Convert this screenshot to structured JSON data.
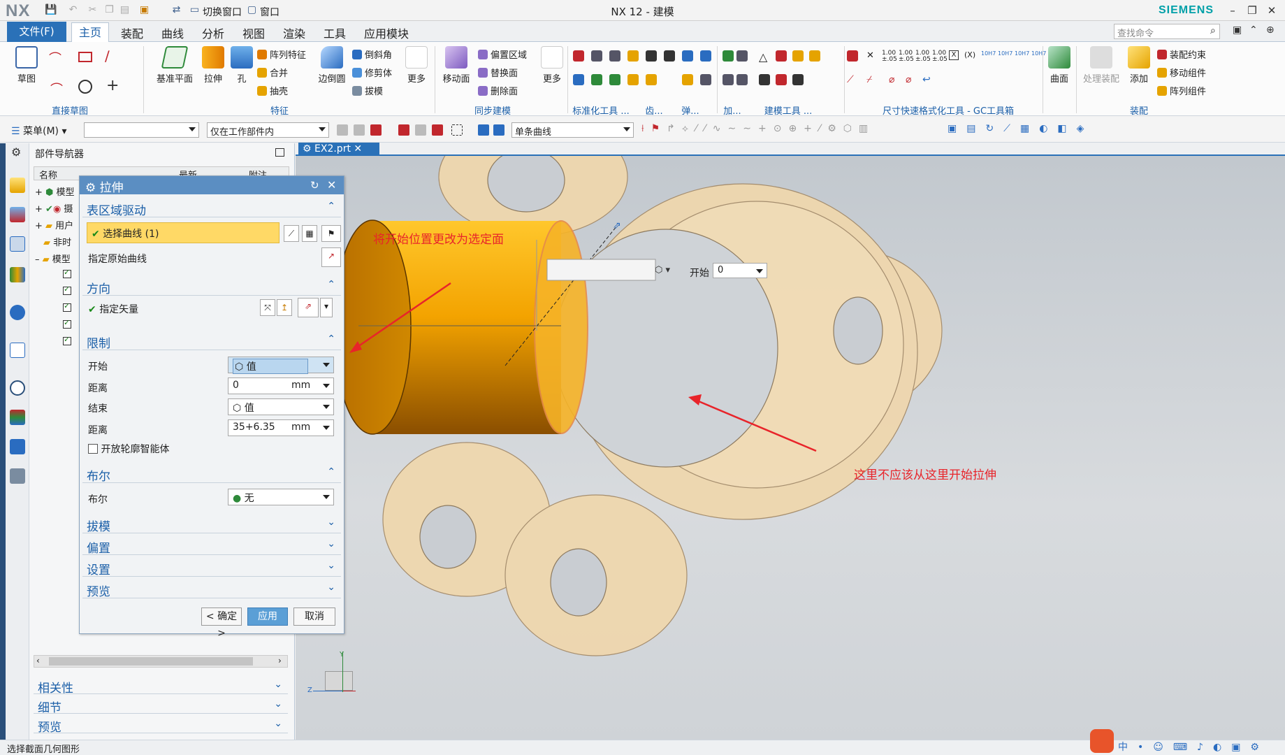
{
  "app": {
    "logo": "NX",
    "title": "NX 12 - 建模",
    "brand": "SIEMENS"
  },
  "quick": {
    "switch_window": "切换窗口",
    "window": "窗口"
  },
  "menu": {
    "file": "文件(F)",
    "tabs": [
      "主页",
      "装配",
      "曲线",
      "分析",
      "视图",
      "渲染",
      "工具",
      "应用模块"
    ],
    "search_placeholder": "查找命令"
  },
  "ribbon": {
    "sketch": "草图",
    "datum_plane": "基准平面",
    "extrude": "拉伸",
    "hole": "孔",
    "pattern_feature": "阵列特征",
    "unite": "合并",
    "shell": "抽壳",
    "edge_blend": "边倒圆",
    "chamfer": "倒斜角",
    "trim_body": "修剪体",
    "draft": "拔模",
    "more1": "更多",
    "move_face": "移动面",
    "offset_region": "偏置区域",
    "replace_face": "替换面",
    "delete_face": "删除面",
    "more2": "更多",
    "surface": "曲面",
    "process_assembly": "处理装配",
    "add": "添加",
    "assembly_constraint": "装配约束",
    "move_component": "移动组件",
    "pattern_component": "阵列组件",
    "groups": [
      "直接草图",
      "特征",
      "同步建模",
      "标准化工具 ...",
      "齿...",
      "弹...",
      "加...",
      "建模工具 ...",
      "尺寸快速格式化工具 - GC工具箱",
      "装配"
    ]
  },
  "toolbar2": {
    "menu": "菜单(M)",
    "filter1": "",
    "scope": "仅在工作部件内",
    "curve_rule": "单条曲线"
  },
  "navigator": {
    "title": "部件导航器",
    "columns": [
      "名称",
      "最新",
      "附注"
    ],
    "rows": [
      "模型",
      "摄",
      "用户",
      "非时",
      "模型"
    ],
    "sections": [
      "相关性",
      "细节",
      "预览"
    ]
  },
  "doc_tab": "EX2.prt",
  "dialog": {
    "title": "拉伸",
    "sec_section": "表区域驱动",
    "select_curve": "选择曲线 (1)",
    "specify_origin_curve": "指定原始曲线",
    "sec_direction": "方向",
    "specify_vector": "指定矢量",
    "sec_limits": "限制",
    "start_label": "开始",
    "start_value": "值",
    "distance_label": "距离",
    "start_distance": "0",
    "unit": "mm",
    "end_label": "结束",
    "end_value": "值",
    "end_distance": "35+6.35",
    "open_profile": "开放轮廓智能体",
    "sec_boolean": "布尔",
    "boolean_label": "布尔",
    "boolean_value": "无",
    "sec_draft": "拔模",
    "sec_offset": "偏置",
    "sec_settings": "设置",
    "sec_preview": "预览",
    "ok": "< 确定 >",
    "apply": "应用",
    "cancel": "取消"
  },
  "onscreen": {
    "start_label": "开始",
    "start_value": "0"
  },
  "annotations": {
    "a1": "将开始位置更改为选定面",
    "a2": "这里不应该从这里开始拉伸"
  },
  "status": "选择截面几何图形",
  "triad": {
    "y": "Y",
    "z": "Z"
  }
}
